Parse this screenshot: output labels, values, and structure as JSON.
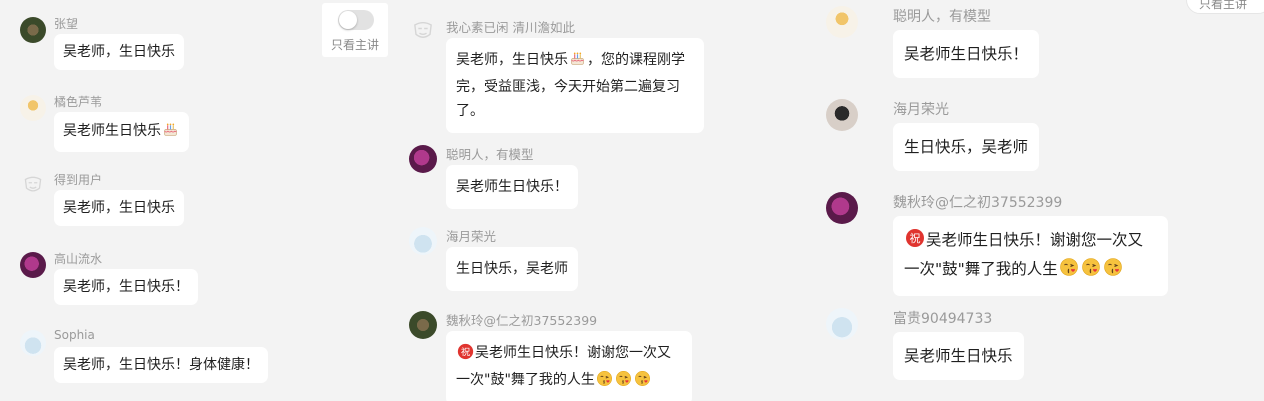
{
  "toggle": {
    "label": "只看主讲",
    "on": false
  },
  "corner_chip": {
    "label": "只看主讲"
  },
  "columns": {
    "left": [
      {
        "name": "张望",
        "avatar": "avatar-user",
        "segments": [
          {
            "text": "吴老师，生日快乐"
          }
        ]
      },
      {
        "name": "橘色芦苇",
        "avatar": "avatar-user",
        "segments": [
          {
            "text": "吴老师生日快乐"
          },
          {
            "icon": "birthday-cake-icon"
          }
        ]
      },
      {
        "name": "得到用户",
        "avatar": "avatar-default",
        "segments": [
          {
            "text": "吴老师，生日快乐"
          }
        ]
      },
      {
        "name": "高山流水",
        "avatar": "avatar-user",
        "segments": [
          {
            "text": "吴老师，生日快乐！"
          }
        ]
      },
      {
        "name": "Sophia",
        "avatar": "avatar-user",
        "segments": [
          {
            "text": "吴老师，生日快乐！身体健康！"
          }
        ]
      }
    ],
    "middle": [
      {
        "name": "我心素已闲 清川澹如此",
        "avatar": "avatar-default",
        "segments": [
          {
            "text": "吴老师，生日快乐"
          },
          {
            "icon": "birthday-cake-icon"
          },
          {
            "text": "，您的课程刚学完，受益匪浅，今天开始第二遍复习了。"
          }
        ]
      },
      {
        "name": "聪明人，有模型",
        "avatar": "avatar-user",
        "segments": [
          {
            "text": "吴老师生日快乐！"
          }
        ]
      },
      {
        "name": "海月荣光",
        "avatar": "avatar-user",
        "segments": [
          {
            "text": "生日快乐，吴老师"
          }
        ]
      },
      {
        "name": "魏秋玲@仁之初37552399",
        "avatar": "avatar-user",
        "segments": [
          {
            "icon": "blessing-badge-icon",
            "badge": "祝"
          },
          {
            "text": "吴老师生日快乐！谢谢您一次又一次\"鼓\"舞了我的人生"
          },
          {
            "icon": "kissing-face-icon"
          },
          {
            "icon": "kissing-face-icon"
          },
          {
            "icon": "kissing-face-icon"
          }
        ]
      }
    ],
    "right": [
      {
        "name": "聪明人，有模型",
        "avatar": "avatar-user",
        "segments": [
          {
            "text": "吴老师生日快乐！"
          }
        ]
      },
      {
        "name": "海月荣光",
        "avatar": "avatar-user",
        "segments": [
          {
            "text": "生日快乐，吴老师"
          }
        ]
      },
      {
        "name": "魏秋玲@仁之初37552399",
        "avatar": "avatar-user",
        "segments": [
          {
            "icon": "blessing-badge-icon",
            "badge": "祝"
          },
          {
            "text": "吴老师生日快乐！谢谢您一次又一次\"鼓\"舞了我的人生"
          },
          {
            "icon": "kissing-face-icon"
          },
          {
            "icon": "kissing-face-icon"
          },
          {
            "icon": "kissing-face-icon"
          }
        ]
      },
      {
        "name": "富贵90494733",
        "avatar": "avatar-user",
        "segments": [
          {
            "text": "吴老师生日快乐"
          }
        ]
      }
    ]
  },
  "colors": {
    "background": "#f3f3f3",
    "bubble": "#ffffff",
    "name": "#9a9a9a",
    "text": "#1f1f1f",
    "badge": "#e0342f"
  }
}
